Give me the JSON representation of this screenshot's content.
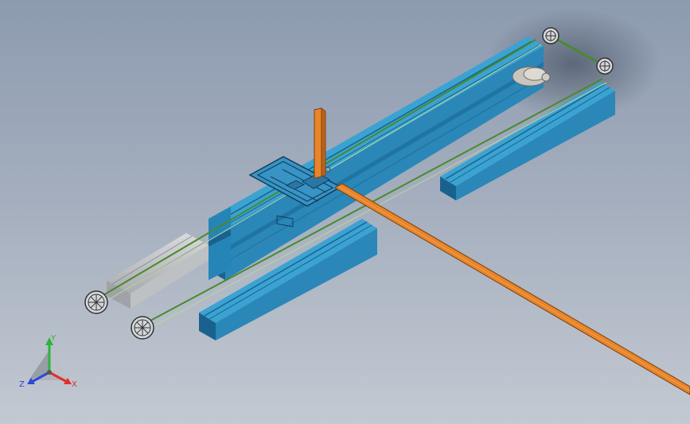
{
  "triad": {
    "x_label": "X",
    "y_label": "Y",
    "z_label": "Z"
  },
  "colors": {
    "background_top": "#8d9bb0",
    "background_bottom": "#c3c9d2",
    "rail_blue": "#2a87b8",
    "rail_blue_dark": "#1a628e",
    "rail_blue_light": "#3aa3d2",
    "belt_green": "#4a8a2a",
    "orange_rod": "#e8852a",
    "grey_channel": "#b9bcbf",
    "x_axis": "#e0302c",
    "y_axis": "#2cb43c",
    "z_axis": "#2c48d8"
  }
}
